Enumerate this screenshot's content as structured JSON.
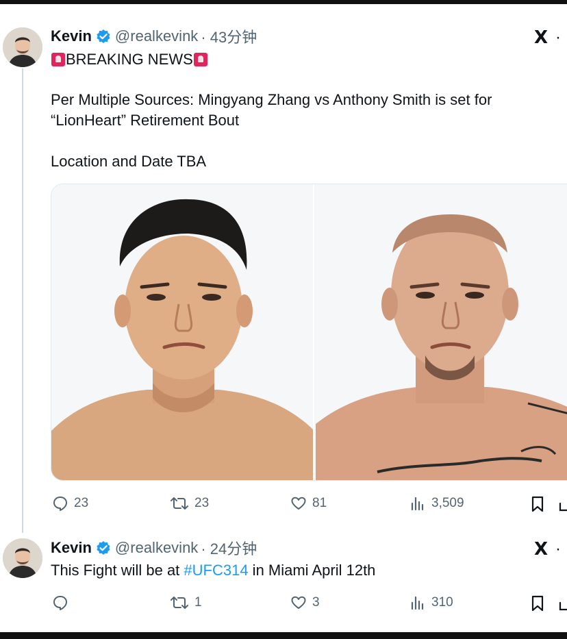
{
  "tweets": [
    {
      "name": "Kevin",
      "handle": "@realkevink",
      "time": "· 43分钟",
      "headline": "BREAKING NEWS",
      "body_line1": "Per Multiple Sources: Mingyang Zhang vs Anthony Smith is set for",
      "body_line2": "“LionHeart” Retirement Bout",
      "body_line3": "Location and Date TBA",
      "stats": {
        "replies": "23",
        "reposts": "23",
        "likes": "81",
        "views": "3,509"
      }
    },
    {
      "name": "Kevin",
      "handle": "@realkevink",
      "time": "· 24分钟",
      "text_before": "This Fight will be at ",
      "hashtag": "#UFC314",
      "text_after": " in Miami April 12th",
      "stats": {
        "replies": "",
        "reposts": "1",
        "likes": "3",
        "views": "310"
      }
    }
  ],
  "icons": {
    "verified": "verified-badge-icon",
    "grok": "grok-icon",
    "more": "more-icon",
    "reply": "reply-icon",
    "repost": "repost-icon",
    "like": "like-icon",
    "views": "views-icon",
    "bookmark": "bookmark-icon",
    "share": "share-icon",
    "siren": "siren-icon"
  },
  "colors": {
    "verified": "#1d9bf0",
    "hashtag": "#1d9bf0",
    "secondary_text": "#536471"
  },
  "grok_label": "X",
  "more_label": "·"
}
